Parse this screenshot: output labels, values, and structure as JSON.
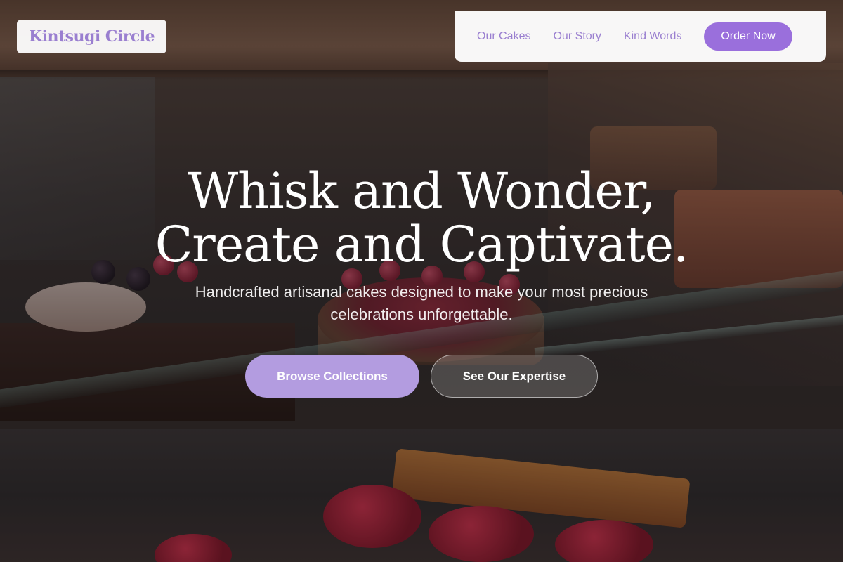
{
  "brand": {
    "name": "Kintsugi Circle"
  },
  "nav": {
    "links": [
      "Our Cakes",
      "Our Story",
      "Kind Words"
    ],
    "cta": "Order Now"
  },
  "hero": {
    "title_line1": "Whisk and Wonder,",
    "title_line2": "Create and Captivate.",
    "subtitle_line1": "Handcrafted artisanal cakes designed to make your most precious",
    "subtitle_line2": "celebrations unforgettable.",
    "primary_button": "Browse Collections",
    "secondary_button": "See Our Expertise"
  },
  "colors": {
    "accent": "#9a6fdc",
    "accent_light": "#b39ce0",
    "logo_text": "#9a7fd0"
  }
}
